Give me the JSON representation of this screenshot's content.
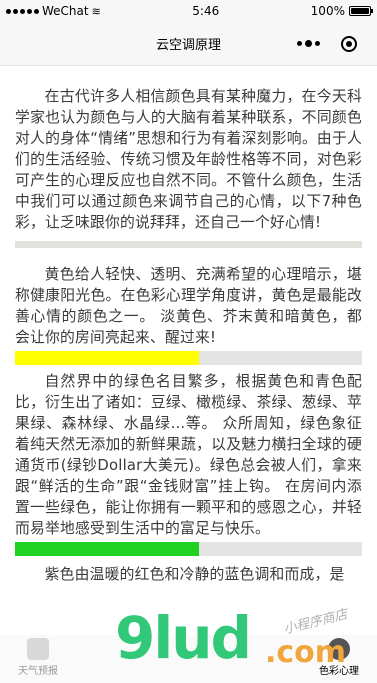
{
  "status_bar": {
    "carrier": "WeChat",
    "time": "5:46",
    "battery": "100%"
  },
  "nav": {
    "title": "云空调原理"
  },
  "paragraphs": [
    "在古代许多人相信颜色具有某种魔力，在今天科学家也认为颜色与人的大脑有着某种联系，不同颜色对人的身体“情绪”思想和行为有着深刻影响。由于人们的生活经验、传统习惯及年龄性格等不同，对色彩可产生的心理反应也自然不同。不管什么颜色，生活中我们可以通过颜色来调节自己的心情，以下7种色彩，让乏味跟你的说拜拜，还自己一个好心情!",
    "黄色给人轻快、透明、充满希望的心理暗示，堪称健康阳光色。在色彩心理学角度讲，黄色是最能改善心情的颜色之一。 淡黄色、芥末黄和暗黄色，都会让你的房间亮起来、醒过来!",
    "自然界中的绿色名目繁多，根据黄色和青色配比，衍生出了诸如：豆绿、橄榄绿、茶绿、葱绿、苹果绿、森林绿、水晶绿...等。 众所周知，绿色象征着纯天然无添加的新鲜果蔬，以及魅力横扫全球的硬通货币(绿钞Dollar大美元)。绿色总会被人们，拿来跟“鲜活的生命”跟“金钱财富”挂上钩。 在房间内添置一些绿色，能让你拥有一颗平和的感恩之心，并轻而易举地感受到生活中的富足与快乐。",
    "紫色由温暖的红色和冷静的蓝色调和而成，是"
  ],
  "color_bars": [
    {
      "name": "yellow",
      "color": "#ffff00",
      "fill": 0.53
    },
    {
      "name": "green",
      "color": "#1fd21f",
      "fill": 0.53
    }
  ],
  "tabs": {
    "weather": "天气预报",
    "psych": "色彩心理"
  },
  "watermark": {
    "letters": "9lud",
    "suffix": ".com",
    "sub": "小程序商店"
  }
}
